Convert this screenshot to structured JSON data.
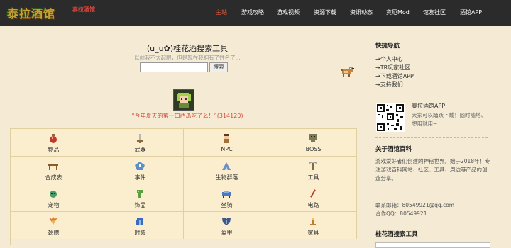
{
  "header": {
    "logo_text": "泰拉酒馆",
    "logo_sub": "泰拉酒馆",
    "nav": [
      {
        "label": "主站",
        "active": true
      },
      {
        "label": "游戏攻略",
        "active": false
      },
      {
        "label": "游戏视频",
        "active": false
      },
      {
        "label": "资源下载",
        "active": false
      },
      {
        "label": "资讯动态",
        "active": false
      },
      {
        "label": "灾厄Mod",
        "active": false
      },
      {
        "label": "馆友社区",
        "active": false
      },
      {
        "label": "酒馆APP",
        "active": false
      }
    ]
  },
  "main": {
    "title": "(u_u✿)桂花酒搜索工具",
    "subtitle": "以前我不太起眼，但是现在我拥有了姓名了...",
    "search_placeholder": "",
    "search_button": "搜索",
    "quote": "“今年夏天的第一口西瓜吃了么！”(314120)"
  },
  "categories": [
    {
      "label": "物品",
      "icon": "potion-icon",
      "color": "#c0392b"
    },
    {
      "label": "武器",
      "icon": "sword-icon",
      "color": "#8a6a3b"
    },
    {
      "label": "NPC",
      "icon": "npc-icon",
      "color": "#a0713b"
    },
    {
      "label": "BOSS",
      "icon": "skull-icon",
      "color": "#7a7a55"
    },
    {
      "label": "合成表",
      "icon": "workbench-icon",
      "color": "#8b5a2b"
    },
    {
      "label": "事件",
      "icon": "event-icon",
      "color": "#5b8fc7"
    },
    {
      "label": "生物群落",
      "icon": "biome-icon",
      "color": "#6a8fc2"
    },
    {
      "label": "工具",
      "icon": "pickaxe-icon",
      "color": "#8a6a3b"
    },
    {
      "label": "宠物",
      "icon": "pet-icon",
      "color": "#4a9a6a"
    },
    {
      "label": "饰品",
      "icon": "accessory-icon",
      "color": "#5aa040"
    },
    {
      "label": "坐骑",
      "icon": "mount-icon",
      "color": "#4a7ac2"
    },
    {
      "label": "电路",
      "icon": "wire-icon",
      "color": "#c0392b"
    },
    {
      "label": "翅膀",
      "icon": "wings-icon",
      "color": "#e07a2a"
    },
    {
      "label": "时装",
      "icon": "vanity-icon",
      "color": "#3b6ac2"
    },
    {
      "label": "盔甲",
      "icon": "armor-icon",
      "color": "#3b5a8a"
    },
    {
      "label": "家具",
      "icon": "furniture-icon",
      "color": "#c07a3b"
    }
  ],
  "sidebar": {
    "quick_nav_title": "快捷导航",
    "quick_links": [
      "→个人中心",
      "→TR玩家社区",
      "→下载酒馆APP",
      "→支持我们"
    ],
    "app_name": "泰拉酒馆APP",
    "app_desc": "大家可以踊跃下载！随时随地、想用就用~",
    "about_title": "关于酒馆百科",
    "about_text": "游戏爱好者们创建的神秘世界。始于2018年！专注游戏百科网站、社区、工具、周边等产品的创造分享。",
    "email": "联系邮箱：80549921@qq.com",
    "qq": "合作QQ：80549921",
    "tool_title": "桂花酒搜索工具"
  }
}
